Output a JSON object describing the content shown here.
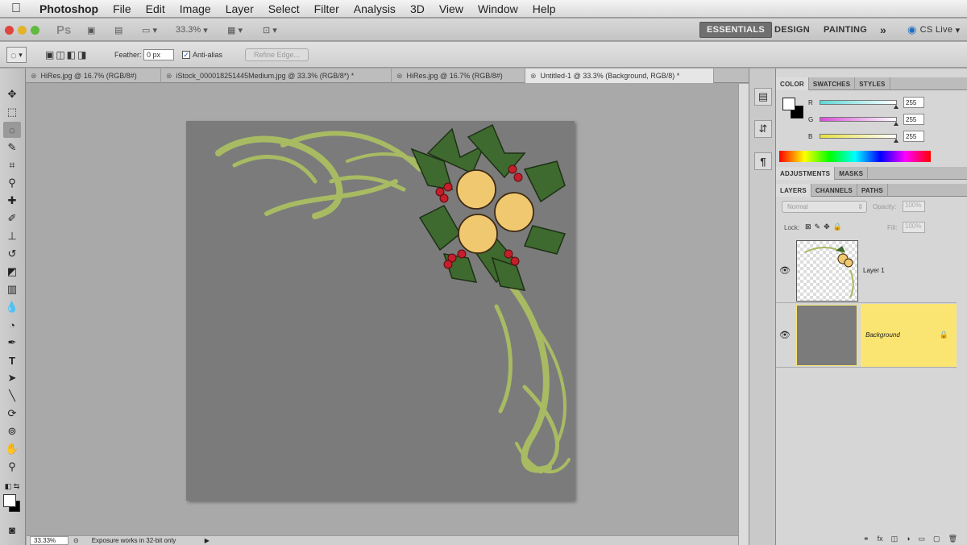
{
  "menubar": {
    "app_name": "Photoshop",
    "items": [
      "File",
      "Edit",
      "Image",
      "Layer",
      "Select",
      "Filter",
      "Analysis",
      "3D",
      "View",
      "Window",
      "Help"
    ]
  },
  "appbar": {
    "ps_label": "Ps",
    "zoom": "33.3%",
    "workspaces": [
      "ESSENTIALS",
      "DESIGN",
      "PAINTING"
    ],
    "more": "»",
    "cslive": "CS Live"
  },
  "options": {
    "feather_label": "Feather:",
    "feather_value": "0 px",
    "antialias_label": "Anti-alias",
    "refine_label": "Refine Edge..."
  },
  "doc_tabs": [
    {
      "label": "HiRes.jpg @ 16.7% (RGB/8#)"
    },
    {
      "label": "iStock_000018251445Medium.jpg @ 33.3% (RGB/8*) *"
    },
    {
      "label": "HiRes.jpg @ 16.7% (RGB/8#)"
    },
    {
      "label": "Untitled-1 @ 33.3% (Background, RGB/8) *"
    }
  ],
  "status": {
    "zoom": "33.33%",
    "message": "Exposure works in 32-bit only"
  },
  "color_panel": {
    "tabs": [
      "COLOR",
      "SWATCHES",
      "STYLES"
    ],
    "channels": [
      {
        "label": "R",
        "value": "255",
        "color": "#5fd6d6"
      },
      {
        "label": "G",
        "value": "255",
        "color": "#d64fd6"
      },
      {
        "label": "B",
        "value": "255",
        "color": "#e6e040"
      }
    ]
  },
  "adjust_panel": {
    "tabs": [
      "ADJUSTMENTS",
      "MASKS"
    ]
  },
  "layers_panel": {
    "tabs": [
      "LAYERS",
      "CHANNELS",
      "PATHS"
    ],
    "blend_mode": "Normal",
    "opacity_label": "Opacity:",
    "opacity_value": "100%",
    "lock_label": "Lock:",
    "fill_label": "Fill:",
    "fill_value": "100%",
    "layers": [
      {
        "name": "Layer 1",
        "selected": false
      },
      {
        "name": "Background",
        "selected": true
      }
    ],
    "selected_color": "#fbe572"
  }
}
